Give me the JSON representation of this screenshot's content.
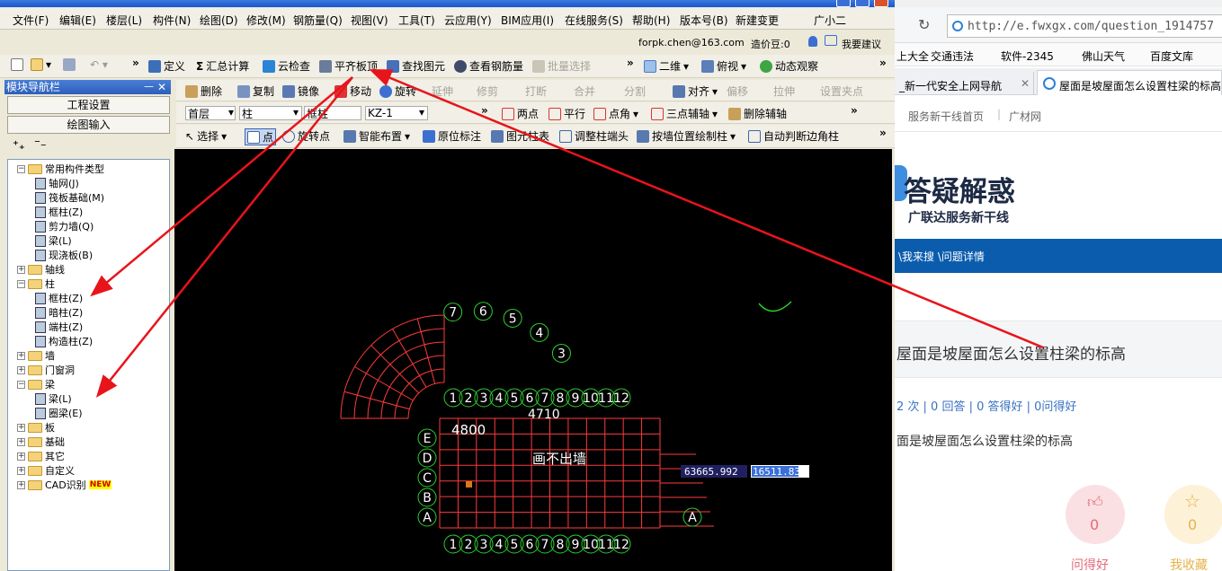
{
  "menus": [
    "文件(F)",
    "编辑(E)",
    "楼层(L)",
    "构件(N)",
    "绘图(D)",
    "修改(M)",
    "钢筋量(Q)",
    "视图(V)",
    "工具(T)",
    "云应用(Y)",
    "BIM应用(I)",
    "在线服务(S)",
    "帮助(H)",
    "版本号(B)",
    "新建变更",
    "广小二"
  ],
  "user": {
    "email": "forpk.chen@163.com",
    "credits": "造价豆:0",
    "suggest": "我要建议"
  },
  "toolbar1": {
    "define": "定义",
    "sum": "汇总计算",
    "cloud_check": "云检查",
    "align_top": "平齐板顶",
    "find": "查找图元",
    "view_rebar": "查看钢筋量",
    "batch_select": "批量选择",
    "mode_2d": "二维",
    "view_top": "俯视",
    "dynamic": "动态观察"
  },
  "toolbar2": {
    "delete": "删除",
    "copy": "复制",
    "mirror": "镜像",
    "move": "移动",
    "rotate": "旋转",
    "extend": "延伸",
    "trim": "修剪",
    "break": "打断",
    "merge": "合并",
    "split": "分割",
    "align": "对齐",
    "offset": "偏移",
    "stretch": "拉伸",
    "set_point": "设置夹点"
  },
  "toolbar3": {
    "floor": "首层",
    "type": "柱",
    "subtype": "框柱",
    "name": "KZ-1",
    "two_points": "两点",
    "parallel": "平行",
    "point_angle": "点角",
    "three_point_axis": "三点辅轴",
    "delete_axis": "删除辅轴"
  },
  "toolbar4": {
    "select": "选择",
    "point": "点",
    "rotate_point": "旋转点",
    "smart_layout": "智能布置",
    "in_place_mark": "原位标注",
    "col_table": "图元柱表",
    "adjust_col_end": "调整柱端头",
    "draw_by_wall": "按墙位置绘制柱",
    "auto_corner": "自动判断边角柱"
  },
  "nav": {
    "title": "模块导航栏",
    "pin": "ᅳ",
    "close": "✕",
    "project_settings": "工程设置",
    "drawing_input": "绘图输入"
  },
  "tree": [
    {
      "label": "常用构件类型",
      "expander": "−"
    },
    {
      "label": "轴网(J)"
    },
    {
      "label": "筏板基础(M)"
    },
    {
      "label": "框柱(Z)"
    },
    {
      "label": "剪力墙(Q)"
    },
    {
      "label": "梁(L)"
    },
    {
      "label": "现浇板(B)"
    },
    {
      "label": "轴线",
      "expander": "+"
    },
    {
      "label": "柱",
      "expander": "−"
    },
    {
      "label": "框柱(Z)"
    },
    {
      "label": "暗柱(Z)"
    },
    {
      "label": "端柱(Z)"
    },
    {
      "label": "构造柱(Z)"
    },
    {
      "label": "墙",
      "expander": "+"
    },
    {
      "label": "门窗洞",
      "expander": "+"
    },
    {
      "label": "梁",
      "expander": "−"
    },
    {
      "label": "梁(L)"
    },
    {
      "label": "圈梁(E)"
    },
    {
      "label": "板",
      "expander": "+"
    },
    {
      "label": "基础",
      "expander": "+"
    },
    {
      "label": "其它",
      "expander": "+"
    },
    {
      "label": "自定义",
      "expander": "+"
    },
    {
      "label": "CAD识别",
      "expander": "+",
      "badge": "NEW"
    }
  ],
  "canvas": {
    "coord_x": "63665.992",
    "coord_y": "16511.83",
    "axis_labels_top": [
      "1",
      "2",
      "3",
      "4",
      "5",
      "6",
      "7",
      "8",
      "9",
      "10",
      "11",
      "12"
    ],
    "axis_labels_bottom": [
      "1",
      "2",
      "3",
      "4",
      "5",
      "6",
      "7",
      "8",
      "9",
      "10",
      "11",
      "12"
    ],
    "axis_labels_left": [
      "A",
      "B",
      "C",
      "D",
      "E"
    ],
    "arc_labels": [
      "7",
      "6",
      "5",
      "4",
      "3"
    ],
    "text1": "画不出墙",
    "text2": "4800",
    "text3": "4710"
  },
  "browser": {
    "url": "http://e.fwxgx.com/question_1914757",
    "fav": [
      "上大全",
      "交通违法",
      "软件-2345",
      "佛山天气",
      "百度文库"
    ],
    "tab1": "_新一代安全上网导航",
    "tab2": "屋面是坡屋面怎么设置柱梁的标高",
    "nav_links": [
      "服务新干线首页",
      "广材网"
    ],
    "logo_title": "答疑解惑",
    "logo_sub": "广联达服务新干线",
    "bluebar": "\\我来搜 \\问题详情",
    "question": "屋面是坡屋面怎么设置柱梁的标高",
    "stats": "2 次 | 0 回答 | 0 答得好 | 0问得好",
    "body": "面是坡屋面怎么设置柱梁的标高",
    "like_count": "0",
    "fav_count": "0",
    "like_label": "问得好",
    "fav_label": "我收藏"
  },
  "colors": {
    "arrow": "#e8141b",
    "canvas_bg": "#000000",
    "grid": "#ff3b3b",
    "axis_circle": "#2bd12b",
    "blue_bar": "#0b5cad"
  }
}
